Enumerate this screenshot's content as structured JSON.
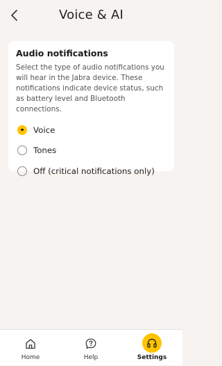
{
  "header": {
    "title": "Voice & AI",
    "back_icon": "chevron-left-icon"
  },
  "audio_notifications": {
    "title": "Audio notifications",
    "description": "Select the type of audio notifications you will hear in the Jabra device. These notifications indicate device status, such as battery level and Bluetooth connections.",
    "options": [
      {
        "label": "Voice",
        "selected": true
      },
      {
        "label": "Tones",
        "selected": false
      },
      {
        "label": "Off (critical notifications only)",
        "selected": false
      }
    ]
  },
  "bottom_nav": {
    "items": [
      {
        "label": "Home",
        "icon": "home-icon",
        "active": false
      },
      {
        "label": "Help",
        "icon": "help-icon",
        "active": false
      },
      {
        "label": "Settings",
        "icon": "headphones-icon",
        "active": true
      }
    ]
  },
  "colors": {
    "accent": "#ffc400",
    "background": "#f6f3f0",
    "card": "#ffffff"
  }
}
